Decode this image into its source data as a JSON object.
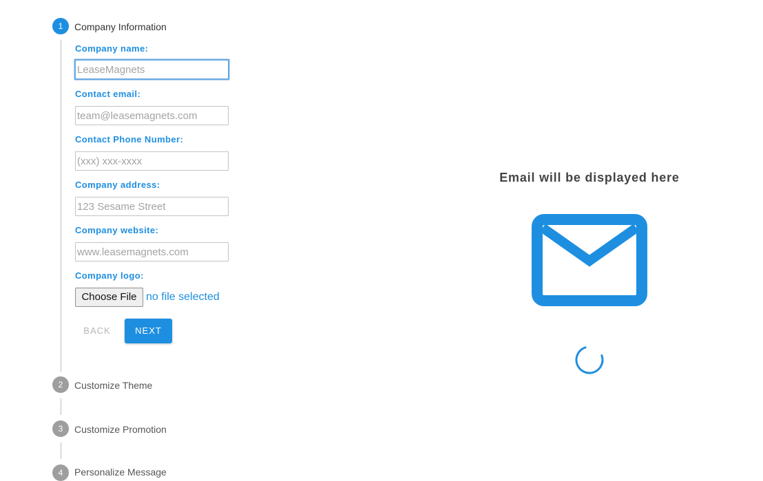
{
  "stepper": {
    "steps": [
      {
        "number": "1",
        "label": "Company Information"
      },
      {
        "number": "2",
        "label": "Customize Theme"
      },
      {
        "number": "3",
        "label": "Customize Promotion"
      },
      {
        "number": "4",
        "label": "Personalize Message"
      }
    ]
  },
  "form": {
    "company_name": {
      "label": "Company name:",
      "placeholder": "LeaseMagnets"
    },
    "contact_email": {
      "label": "Contact email:",
      "placeholder": "team@leasemagnets.com"
    },
    "contact_phone": {
      "label": "Contact Phone Number:",
      "placeholder": "(xxx) xxx-xxxx"
    },
    "company_address": {
      "label": "Company address:",
      "placeholder": "123 Sesame Street"
    },
    "company_website": {
      "label": "Company website:",
      "placeholder": "www.leasemagnets.com"
    },
    "company_logo": {
      "label": "Company logo:",
      "choose_label": "Choose File",
      "status": "no file selected"
    },
    "back_label": "BACK",
    "next_label": "NEXT"
  },
  "preview": {
    "title": "Email will be displayed here",
    "icon": "envelope-icon",
    "loader": "spinner-icon",
    "accent_color": "#1e8fe0"
  }
}
